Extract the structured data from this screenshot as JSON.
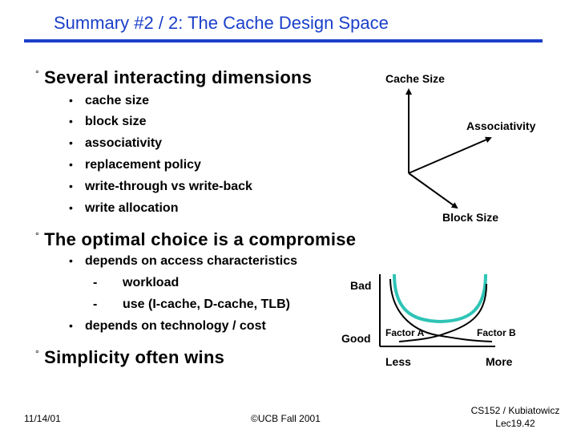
{
  "slide": {
    "title": "Summary #2 / 2: The Cache Design Space",
    "sections": [
      {
        "heading": "Several interacting dimensions",
        "items": [
          {
            "text": "cache size"
          },
          {
            "text": "block size"
          },
          {
            "text": "associativity"
          },
          {
            "text": "replacement policy"
          },
          {
            "text": "write-through vs write-back"
          },
          {
            "text": "write allocation"
          }
        ]
      },
      {
        "heading": "The optimal choice is a compromise",
        "items": [
          {
            "text": "depends on access characteristics",
            "subitems": [
              "workload",
              "use (I-cache, D-cache, TLB)"
            ]
          },
          {
            "text": "depends on technology / cost"
          }
        ]
      },
      {
        "heading": "Simplicity often wins",
        "items": []
      }
    ],
    "bullet_glyph": "°",
    "subbullet_glyph": "•",
    "dash_glyph": "-"
  },
  "design_space_diagram": {
    "axes": [
      "Cache Size",
      "Associativity",
      "Block Size"
    ]
  },
  "tradeoff_diagram": {
    "y_labels": {
      "top": "Bad",
      "bottom": "Good"
    },
    "x_labels": {
      "left": "Less",
      "right": "More"
    },
    "curve_labels": {
      "a": "Factor A",
      "b": "Factor B"
    },
    "colors": {
      "combined_curve": "#2ec4b6",
      "factor_curves": "#000000"
    }
  },
  "footer": {
    "date": "11/14/01",
    "copyright": "©UCB Fall 2001",
    "course": "CS152 / Kubiatowicz",
    "lecture": "Lec19.42"
  }
}
